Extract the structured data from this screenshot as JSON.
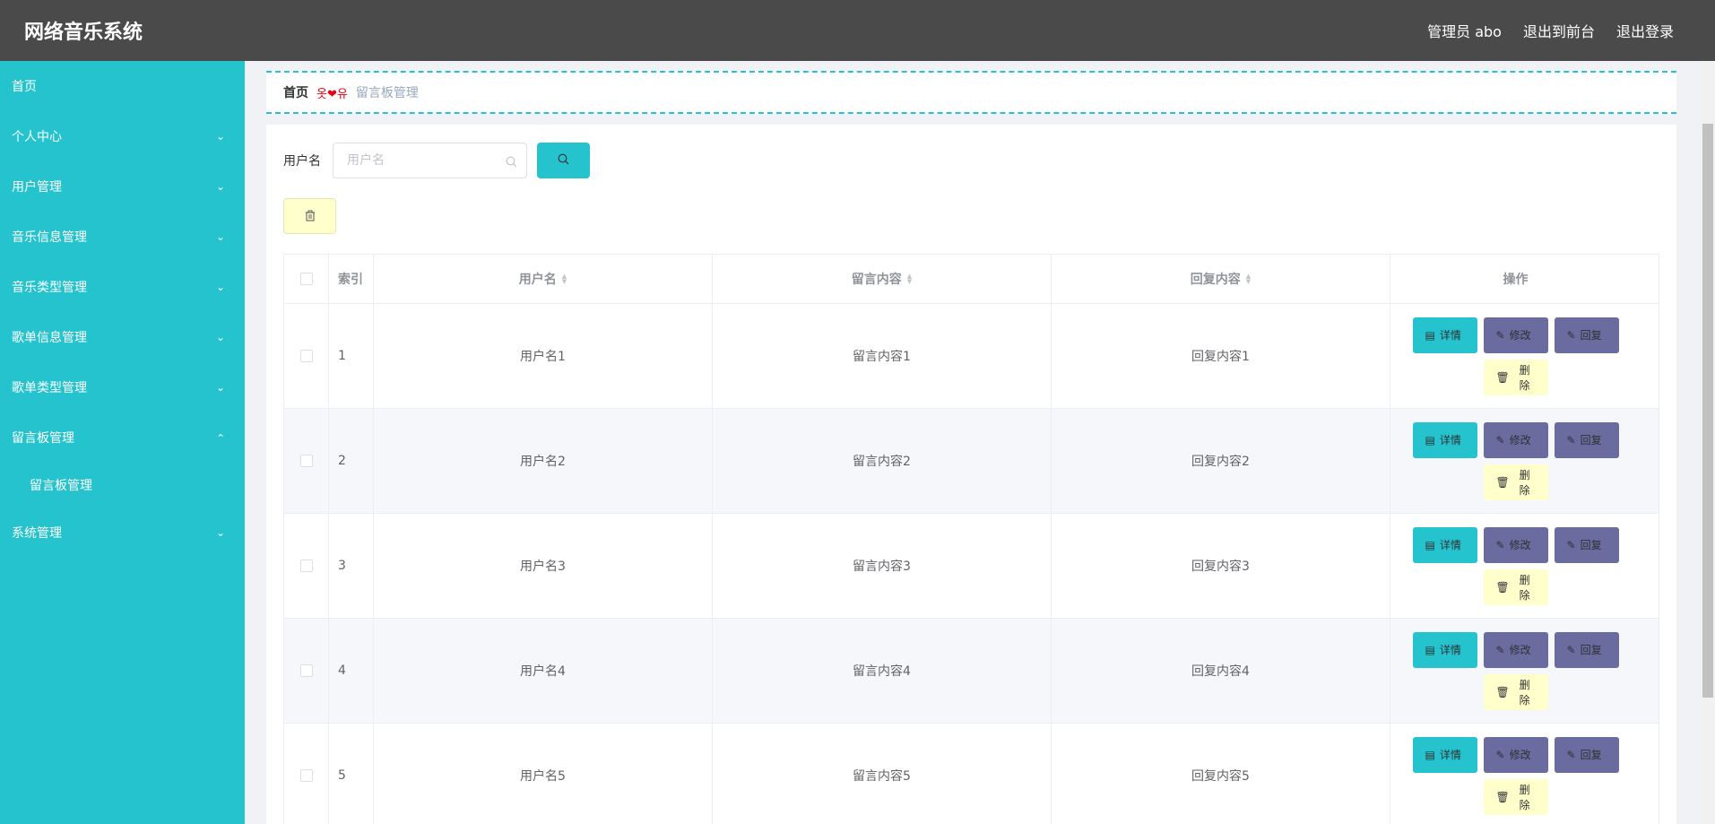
{
  "header": {
    "title": "网络音乐系统",
    "admin_label": "管理员 abo",
    "front_label": "退出到前台",
    "logout_label": "退出登录"
  },
  "sidebar": {
    "items": [
      {
        "label": "首页"
      },
      {
        "label": "个人中心"
      },
      {
        "label": "用户管理"
      },
      {
        "label": "音乐信息管理"
      },
      {
        "label": "音乐类型管理"
      },
      {
        "label": "歌单信息管理"
      },
      {
        "label": "歌单类型管理"
      },
      {
        "label": "留言板管理"
      },
      {
        "label": "系统管理"
      }
    ],
    "sub_item": "留言板管理"
  },
  "breadcrumb": {
    "home": "首页",
    "separator": "옷❤유",
    "current": "留言板管理"
  },
  "search": {
    "label": "用户名",
    "placeholder": "用户名"
  },
  "table": {
    "headers": {
      "index": "索引",
      "username": "用户名",
      "message": "留言内容",
      "reply": "回复内容",
      "ops": "操作"
    },
    "rows": [
      {
        "index": "1",
        "username": "用户名1",
        "message": "留言内容1",
        "reply": "回复内容1"
      },
      {
        "index": "2",
        "username": "用户名2",
        "message": "留言内容2",
        "reply": "回复内容2"
      },
      {
        "index": "3",
        "username": "用户名3",
        "message": "留言内容3",
        "reply": "回复内容3"
      },
      {
        "index": "4",
        "username": "用户名4",
        "message": "留言内容4",
        "reply": "回复内容4"
      },
      {
        "index": "5",
        "username": "用户名5",
        "message": "留言内容5",
        "reply": "回复内容5"
      }
    ],
    "buttons": {
      "detail": "详情",
      "edit": "修改",
      "reply": "回复",
      "delete": "删除"
    }
  },
  "colors": {
    "topbar": "#4a4a4a",
    "sidebar": "#25c3ce",
    "accent": "#25c3ce",
    "edit_btn": "#6a6b9e",
    "delete_btn": "#ffffcc"
  }
}
